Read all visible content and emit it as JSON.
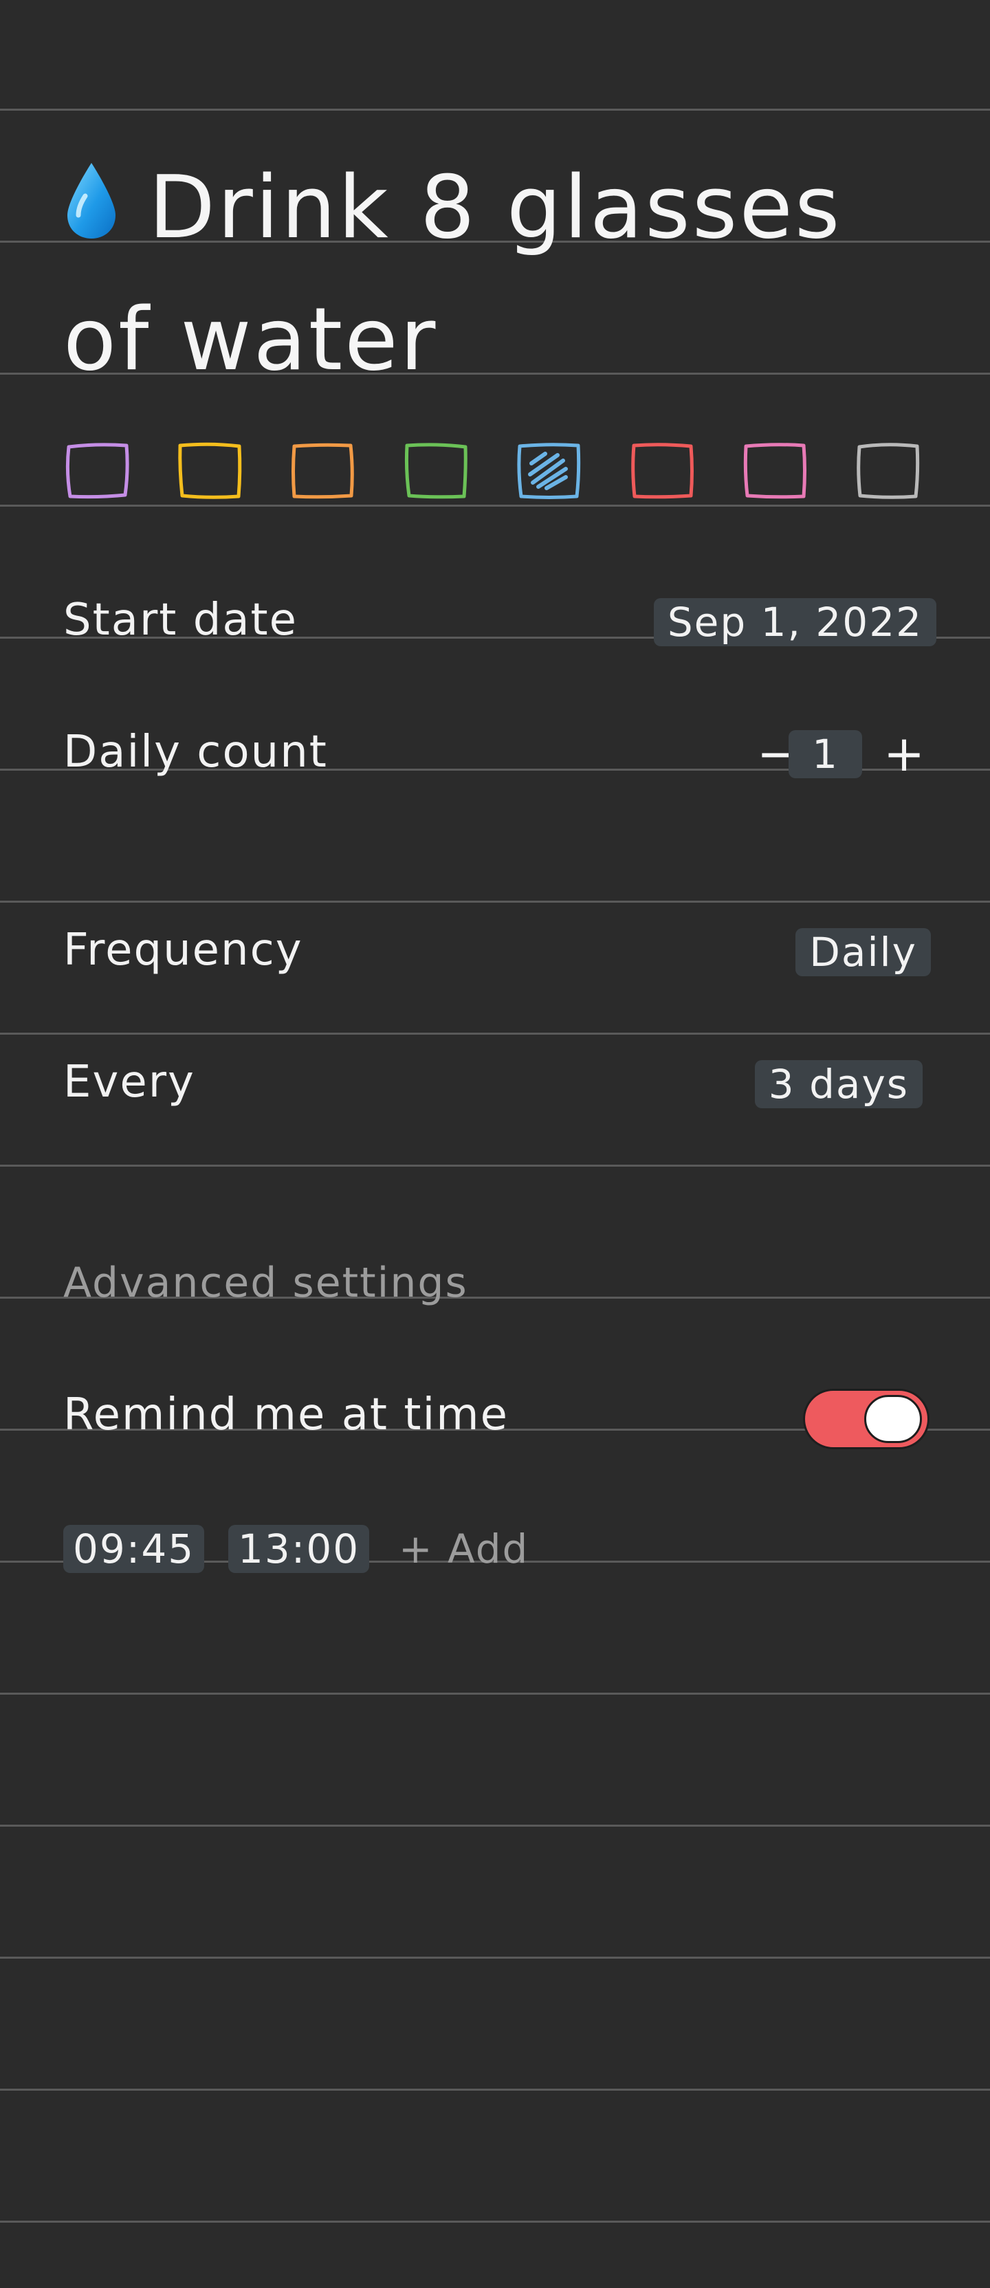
{
  "habit": {
    "icon": "droplet-icon",
    "title": "Drink 8 glasses of water"
  },
  "colors": {
    "selected_index": 4,
    "swatches": [
      {
        "name": "purple",
        "hex": "#c58ee6"
      },
      {
        "name": "yellow",
        "hex": "#f5be1d"
      },
      {
        "name": "orange",
        "hex": "#f29a45"
      },
      {
        "name": "green",
        "hex": "#6bc257"
      },
      {
        "name": "blue",
        "hex": "#6bb4e6"
      },
      {
        "name": "red",
        "hex": "#ef5a5a"
      },
      {
        "name": "pink",
        "hex": "#e87ab6"
      },
      {
        "name": "gray",
        "hex": "#b9b9b9"
      }
    ]
  },
  "start_date": {
    "label": "Start date",
    "value": "Sep 1, 2022"
  },
  "daily_count": {
    "label": "Daily count",
    "value": "1",
    "decrement_symbol": "−",
    "increment_symbol": "+"
  },
  "frequency": {
    "label": "Frequency",
    "value": "Daily"
  },
  "every": {
    "label": "Every",
    "value": "3 days"
  },
  "advanced": {
    "section_label": "Advanced settings"
  },
  "reminder": {
    "label": "Remind me at time",
    "enabled": true,
    "toggle_color": "#ee5a5e",
    "times": [
      "09:45",
      "13:00"
    ],
    "add_label": "+ Add"
  }
}
